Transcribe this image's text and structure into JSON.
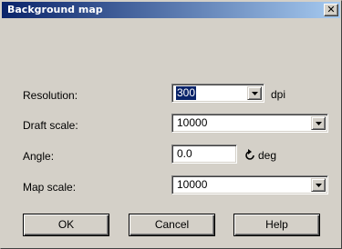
{
  "window": {
    "title": "Background map",
    "close_label": "✕",
    "close_icon": "close-icon"
  },
  "form": {
    "resolution": {
      "label": "Resolution:",
      "value": "300",
      "unit": "dpi"
    },
    "draft_scale": {
      "label": "Draft scale:",
      "value": "10000"
    },
    "angle": {
      "label": "Angle:",
      "value": "0.0",
      "unit": "deg",
      "icon": "rotate-icon"
    },
    "map_scale": {
      "label": "Map scale:",
      "value": "10000"
    }
  },
  "buttons": {
    "ok": "OK",
    "cancel": "Cancel",
    "help": "Help"
  },
  "colors": {
    "dialog_bg": "#d4d0c8",
    "title_bar_start": "#0a246a",
    "title_bar_end": "#a6caf0",
    "selection": "#0a246a"
  }
}
